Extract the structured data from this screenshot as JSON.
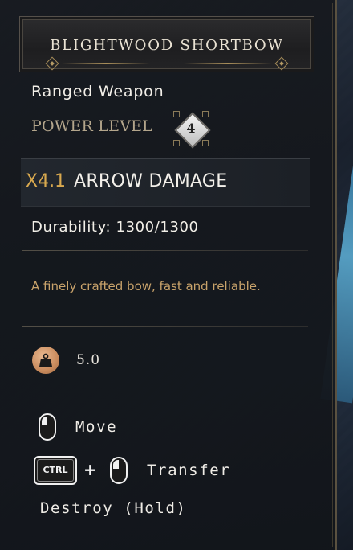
{
  "item": {
    "name": "BLIGHTWOOD SHORTBOW",
    "type": "Ranged Weapon",
    "power_level_label": "POWER LEVEL",
    "power_level_value": "4",
    "damage_multiplier": "X4.1",
    "damage_label": "ARROW DAMAGE",
    "durability": "Durability: 1300/1300",
    "description": "A finely crafted bow, fast and reliable.",
    "weight": "5.0"
  },
  "controls": {
    "move_label": "Move",
    "ctrl_key_label": "CTRL",
    "plus_symbol": "+",
    "transfer_label": "Transfer",
    "destroy_label": "Destroy (Hold)"
  },
  "colors": {
    "accent_gold": "#d9a94f",
    "description_gold": "#c9a36b",
    "power_level_text": "#b4a68c",
    "weight_icon": "#c98b5d"
  },
  "icons": {
    "weight": "weight-icon",
    "mouse": "mouse-left-click-icon",
    "power": "power-level-diamond-icon"
  }
}
